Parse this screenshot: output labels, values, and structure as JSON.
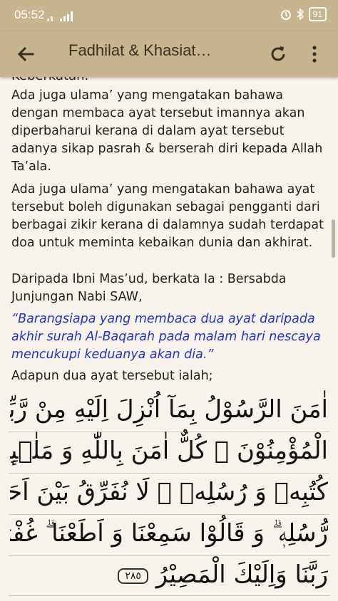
{
  "status_bar": {
    "time": "05:52",
    "battery": "91"
  },
  "app_bar": {
    "title": "Fadhilat & Khasiat…"
  },
  "content": {
    "partial_top": "Keberkatan.",
    "p1": "Ada juga ulama’ yang mengatakan bahawa dengan membaca ayat tersebut imannya akan diperbaharui kerana di dalam ayat tersebut adanya sikap pasrah & berserah diri kepada Allah Ta’ala.",
    "p2": "Ada juga ulama’ yang mengatakan bahawa ayat tersebut boleh digunakan sebagai pengganti dari berbagai zikir kerana di dalamnya sudah terdapat doa untuk meminta kebaikan dunia dan akhirat.",
    "p3": "Daripada Ibni Mas’ud, berkata Ia : Bersabda Junjungan Nabi SAW,",
    "quote": "“Barangsiapa yang membaca dua ayat daripada akhir surah Al-Baqarah pada malam hari nescaya mencukupi keduanya akan dia.”",
    "p4": "Adapun dua ayat tersebut ialah;",
    "arabic": [
      "اٰمَنَ الرَّسُوْلُ بِمَآ اُنْزِلَ اِلَيْهِ مِنْ رَّبِّهٖ وَ",
      "الْمُؤْمِنُوْنَ ۗ كُلٌّ اٰمَنَ بِاللّٰهِ وَ مَلٰۤىِٕكَتِهٖ وَ",
      "كُتُبِهٖ وَ رُسُلِهٖ ۗ لَا نُفَرِّقُ بَيْنَ اَحَدٍ مِّنْ",
      "رُّسُلِهٖ ۗ وَ قَالُوْا سَمِعْنَا وَ اَطَعْنَا ۗ غُفْرَانَكَ",
      "رَبَّنَا وَاِلَيْكَ الْمَصِيْرُ"
    ],
    "ayah_number": "٢٨٥"
  }
}
